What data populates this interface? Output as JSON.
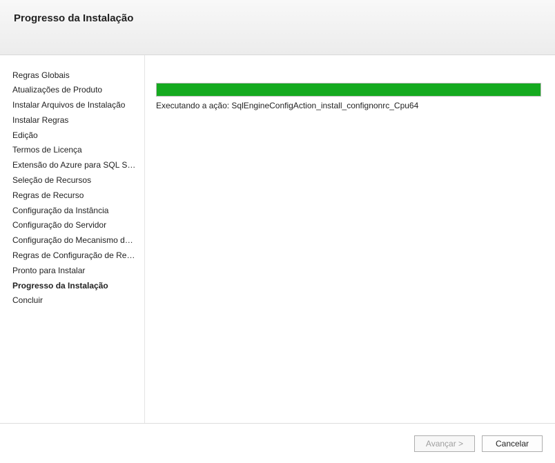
{
  "header": {
    "title": "Progresso da Instalação"
  },
  "sidebar": {
    "items": [
      {
        "label": "Regras Globais",
        "active": false
      },
      {
        "label": "Atualizações de Produto",
        "active": false
      },
      {
        "label": "Instalar Arquivos de Instalação",
        "active": false
      },
      {
        "label": "Instalar Regras",
        "active": false
      },
      {
        "label": "Edição",
        "active": false
      },
      {
        "label": "Termos de Licença",
        "active": false
      },
      {
        "label": "Extensão do Azure para SQL Ser…",
        "active": false
      },
      {
        "label": "Seleção de Recursos",
        "active": false
      },
      {
        "label": "Regras de Recurso",
        "active": false
      },
      {
        "label": "Configuração da Instância",
        "active": false
      },
      {
        "label": "Configuração do Servidor",
        "active": false
      },
      {
        "label": "Configuração do Mecanismo d…",
        "active": false
      },
      {
        "label": "Regras de Configuração de Rec…",
        "active": false
      },
      {
        "label": "Pronto para Instalar",
        "active": false
      },
      {
        "label": "Progresso da Instalação",
        "active": true
      },
      {
        "label": "Concluir",
        "active": false
      }
    ]
  },
  "main": {
    "progress_percent": 100,
    "status_text": "Executando a ação: SqlEngineConfigAction_install_confignonrc_Cpu64"
  },
  "footer": {
    "next_label": "Avançar >",
    "cancel_label": "Cancelar",
    "next_enabled": false
  }
}
